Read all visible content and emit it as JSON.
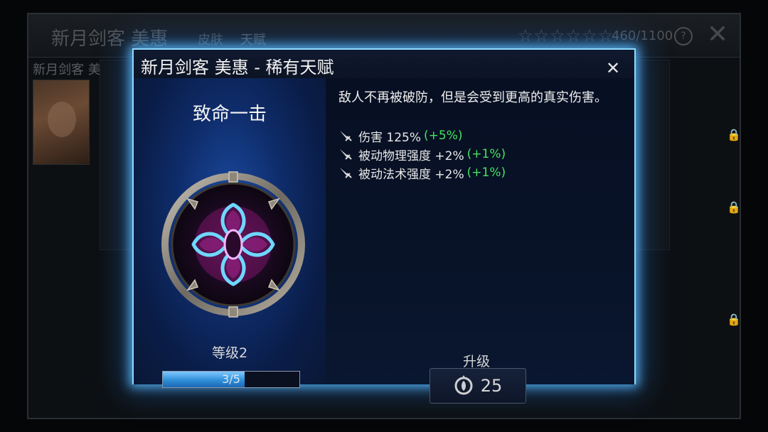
{
  "background": {
    "title": "新月剑客 美惠",
    "tabs": [
      "皮肤",
      "天赋"
    ],
    "stars": "☆☆☆☆☆☆",
    "points": "460/1100",
    "help": "?",
    "close": "✕",
    "subtitle": "新月剑客 美惠"
  },
  "dialog": {
    "title": "新月剑客 美惠 - 稀有天赋",
    "close": "✕",
    "talent_name": "致命一击",
    "level": "等级2",
    "progress": {
      "text": "3/5",
      "current": 3,
      "max": 5
    },
    "description": "敌人不再被破防，但是会受到更高的真实伤害。",
    "stats": [
      {
        "label": "伤害 125%",
        "bonus": "(+5%)"
      },
      {
        "label": "被动物理强度 +2%",
        "bonus": "(+1%)"
      },
      {
        "label": "被动法术强度 +2%",
        "bonus": "(+1%)"
      }
    ],
    "upgrade_label": "升级",
    "upgrade_cost": "25"
  },
  "colors": {
    "accent_border": "#8fd9ff",
    "bonus_green": "#45e35f",
    "progress_fill": "#2f8fd8"
  }
}
